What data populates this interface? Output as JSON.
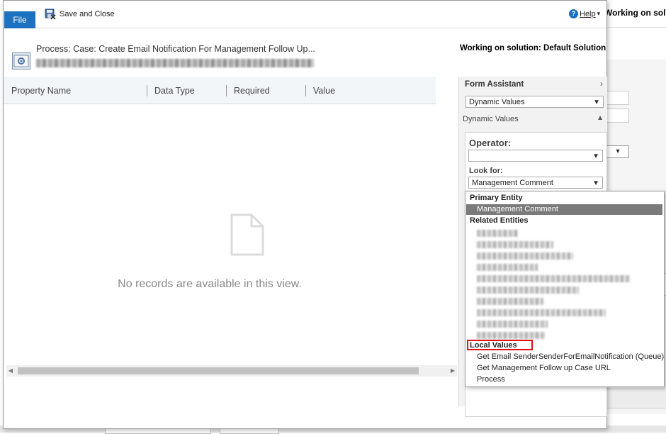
{
  "background": {
    "working_title": "Working on soluti",
    "select_caret": "▾"
  },
  "ribbon": {
    "file_tab": "File",
    "save_close": "Save and Close",
    "help": "Help",
    "help_caret": "▾"
  },
  "process": {
    "title": "Process: Case: Create Email Notification For Management Follow Up...",
    "working_on": "Working on solution: Default Solution"
  },
  "grid": {
    "columns": [
      "Property Name",
      "Data Type",
      "Required",
      "Value"
    ],
    "empty_message": "No records are available in this view."
  },
  "form_assistant": {
    "title": "Form Assistant",
    "chevron": "›",
    "dynamic_values_select": "Dynamic Values",
    "dynamic_values_label": "Dynamic Values",
    "collapse_arrow": "▲",
    "operator_label": "Operator:",
    "operator_value": "",
    "lookfor_label": "Look for:",
    "lookfor_value": "Management Comment"
  },
  "lookup_list": {
    "primary_group": "Primary Entity",
    "primary_selected": "Management Comment",
    "related_group": "Related Entities",
    "local_group": "Local Values",
    "local_items": [
      "Get Email SenderSenderForEmailNotification (Queue)",
      "Get Management Follow up Case URL",
      "Process"
    ]
  },
  "colors": {
    "file_tab": "#1c72c0",
    "selected_item": "#7a7a7a",
    "highlight_border": "#d11111"
  },
  "icons": [
    "save-close-icon",
    "help-icon",
    "process-icon",
    "document-icon",
    "chevron-down-icon",
    "chevron-right-icon",
    "collapse-up-icon"
  ]
}
